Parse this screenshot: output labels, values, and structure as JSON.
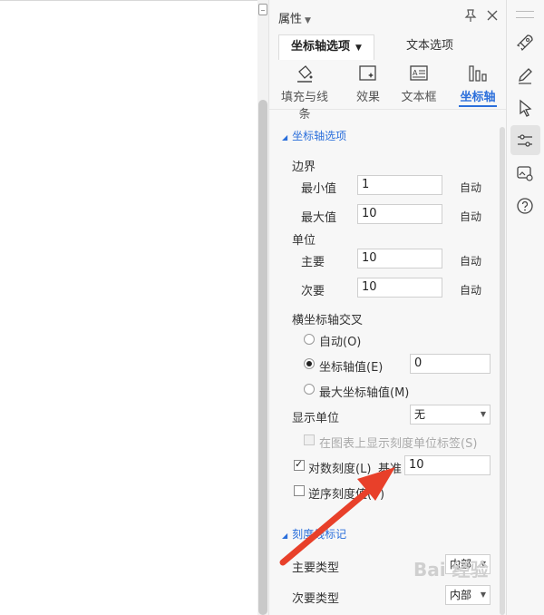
{
  "panel": {
    "title": "属性"
  },
  "tabs": [
    {
      "label": "坐标轴选项"
    },
    {
      "label": "文本选项"
    }
  ],
  "icon_tabs": [
    {
      "label": "填充与线条",
      "icon": "fill-bucket-icon"
    },
    {
      "label": "效果",
      "icon": "effects-icon"
    },
    {
      "label": "文本框",
      "icon": "textbox-icon"
    },
    {
      "label": "坐标轴",
      "icon": "axis-bars-icon",
      "active": true
    }
  ],
  "axis_options": {
    "section_title": "坐标轴选项",
    "bounds_label": "边界",
    "min_label": "最小值",
    "min_value": "1",
    "min_auto": "自动",
    "max_label": "最大值",
    "max_value": "10",
    "max_auto": "自动",
    "units_label": "单位",
    "major_label": "主要",
    "major_value": "10",
    "major_auto": "自动",
    "minor_label": "次要",
    "minor_value": "10",
    "minor_auto": "自动",
    "cross_label": "横坐标轴交叉",
    "cross_auto": "自动(O)",
    "cross_value_label": "坐标轴值(E)",
    "cross_value": "0",
    "cross_max": "最大坐标轴值(M)",
    "display_units_label": "显示单位",
    "display_units_value": "无",
    "show_units_label": "在图表上显示刻度单位标签(S)",
    "log_label": "对数刻度(L)",
    "base_label": "基准",
    "base_value": "10",
    "reverse_label": "逆序刻度值(V)"
  },
  "tick_marks": {
    "section_title": "刻度线标记",
    "major_type_label": "主要类型",
    "major_type_value": "内部",
    "minor_type_label": "次要类型",
    "minor_type_value": "内部"
  },
  "right_bar": {
    "icons": [
      "rocket-icon",
      "pen-icon",
      "cursor-icon",
      "properties-sliders-icon",
      "image-settings-icon",
      "help-icon"
    ]
  },
  "colors": {
    "accent": "#2b6fdb",
    "annotation_arrow": "#e8402a"
  }
}
